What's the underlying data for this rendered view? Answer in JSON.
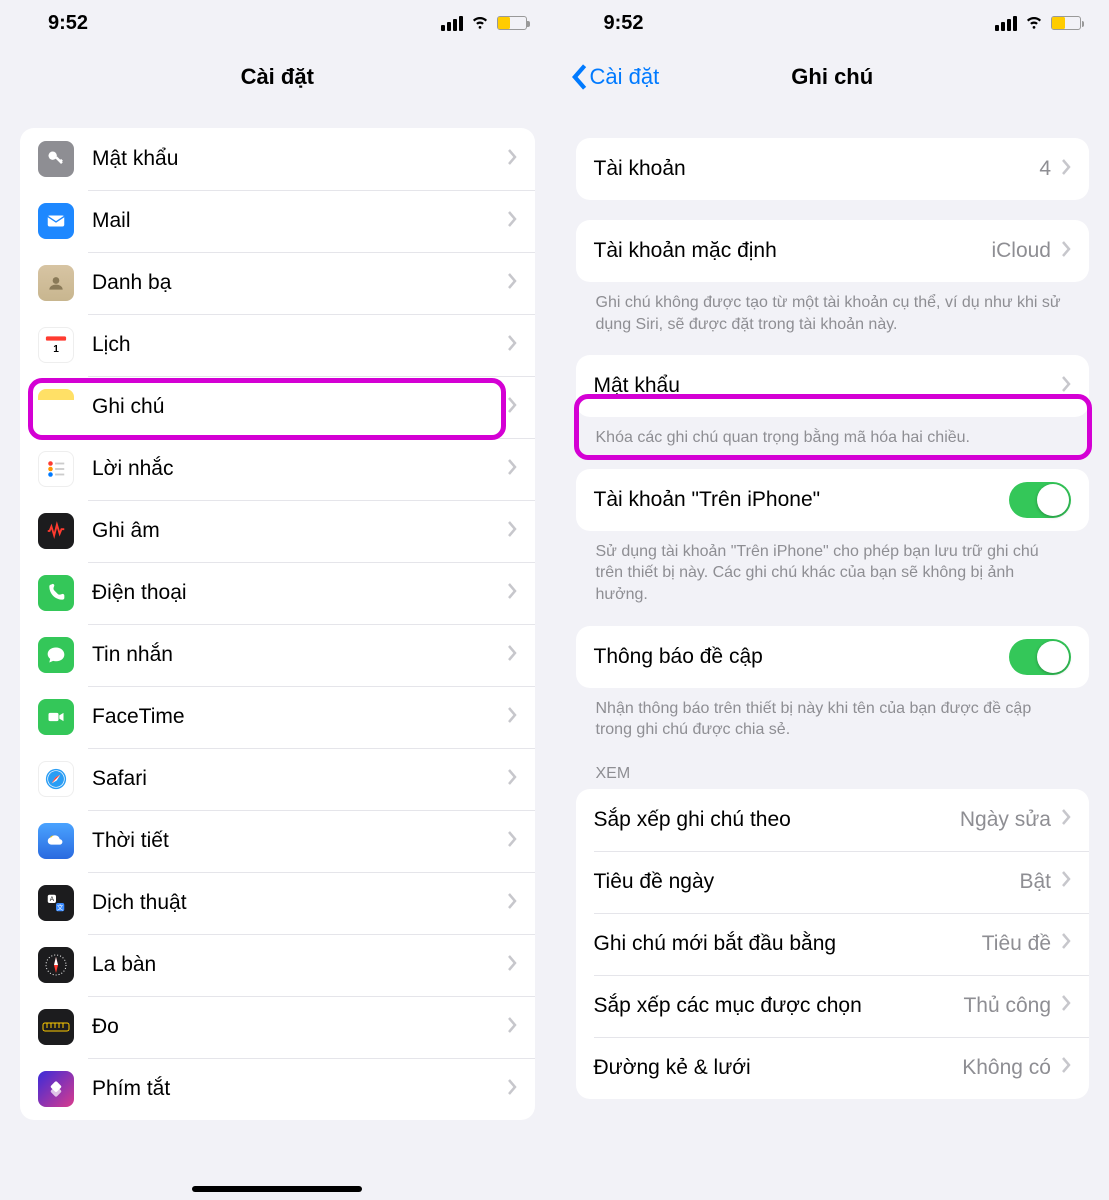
{
  "status": {
    "time": "9:52"
  },
  "left": {
    "title": "Cài đặt",
    "rows": [
      {
        "icon": "key-icon",
        "label": "Mật khẩu"
      },
      {
        "icon": "mail-icon",
        "label": "Mail"
      },
      {
        "icon": "contacts-icon",
        "label": "Danh bạ"
      },
      {
        "icon": "calendar-icon",
        "label": "Lịch"
      },
      {
        "icon": "notes-icon",
        "label": "Ghi chú"
      },
      {
        "icon": "reminders-icon",
        "label": "Lời nhắc"
      },
      {
        "icon": "voice-memos-icon",
        "label": "Ghi âm"
      },
      {
        "icon": "phone-icon",
        "label": "Điện thoại"
      },
      {
        "icon": "messages-icon",
        "label": "Tin nhắn"
      },
      {
        "icon": "facetime-icon",
        "label": "FaceTime"
      },
      {
        "icon": "safari-icon",
        "label": "Safari"
      },
      {
        "icon": "weather-icon",
        "label": "Thời tiết"
      },
      {
        "icon": "translate-icon",
        "label": "Dịch thuật"
      },
      {
        "icon": "compass-icon",
        "label": "La bàn"
      },
      {
        "icon": "measure-icon",
        "label": "Đo"
      },
      {
        "icon": "shortcuts-icon",
        "label": "Phím tắt"
      }
    ]
  },
  "right": {
    "back": "Cài đặt",
    "title": "Ghi chú",
    "accounts": {
      "label": "Tài khoản",
      "value": "4"
    },
    "default_account": {
      "label": "Tài khoản mặc định",
      "value": "iCloud"
    },
    "default_account_footer": "Ghi chú không được tạo từ một tài khoản cụ thể, ví dụ như khi sử dụng Siri, sẽ được đặt trong tài khoản này.",
    "password": {
      "label": "Mật khẩu"
    },
    "password_footer": "Khóa các ghi chú quan trọng bằng mã hóa hai chiều.",
    "on_iphone": {
      "label": "Tài khoản \"Trên iPhone\""
    },
    "on_iphone_footer": "Sử dụng tài khoản \"Trên iPhone\" cho phép bạn lưu trữ ghi chú trên thiết bị này. Các ghi chú khác của bạn sẽ không bị ảnh hưởng.",
    "mentions": {
      "label": "Thông báo đề cập"
    },
    "mentions_footer": "Nhận thông báo trên thiết bị này khi tên của bạn được đề cập trong ghi chú được chia sẻ.",
    "view_header": "XEM",
    "sort": {
      "label": "Sắp xếp ghi chú theo",
      "value": "Ngày sửa"
    },
    "date_headers": {
      "label": "Tiêu đề ngày",
      "value": "Bật"
    },
    "new_start": {
      "label": "Ghi chú mới bắt đầu bằng",
      "value": "Tiêu đề"
    },
    "sort_checked": {
      "label": "Sắp xếp các mục được chọn",
      "value": "Thủ công"
    },
    "lines_grids": {
      "label": "Đường kẻ & lưới",
      "value": "Không có"
    }
  }
}
